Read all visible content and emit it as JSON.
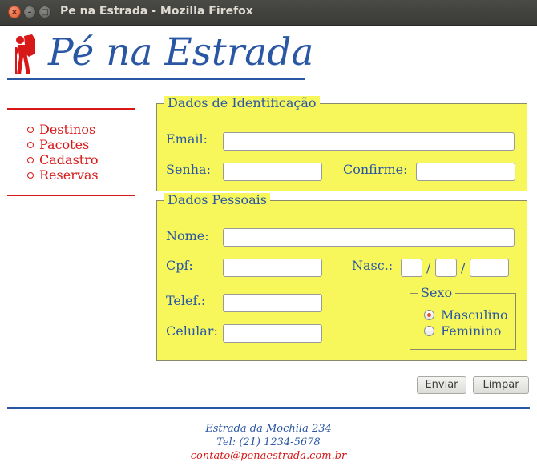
{
  "window": {
    "title": "Pe na Estrada - Mozilla Firefox"
  },
  "colors": {
    "brand_blue": "#2a57a4",
    "menu_red": "#d81818",
    "form_yellow": "#f7f75c"
  },
  "header": {
    "logo_icon": "hiker-icon",
    "brand": "Pé na Estrada"
  },
  "menu": {
    "items": [
      {
        "label": "Destinos"
      },
      {
        "label": "Pacotes"
      },
      {
        "label": "Cadastro"
      },
      {
        "label": "Reservas"
      }
    ]
  },
  "identification": {
    "legend": "Dados de Identificação",
    "email_label": "Email:",
    "email_value": "",
    "senha_label": "Senha:",
    "senha_value": "",
    "confirme_label": "Confirme:",
    "confirme_value": ""
  },
  "personal": {
    "legend": "Dados Pessoais",
    "nome_label": "Nome:",
    "nome_value": "",
    "cpf_label": "Cpf:",
    "cpf_value": "",
    "nasc_label": "Nasc.:",
    "nasc_day": "",
    "nasc_month": "",
    "nasc_year": "",
    "date_separator": "/",
    "telef_label": "Telef.:",
    "telef_value": "",
    "celular_label": "Celular:",
    "celular_value": ""
  },
  "sexo": {
    "legend": "Sexo",
    "options": [
      {
        "label": "Masculino",
        "checked": true
      },
      {
        "label": "Feminino",
        "checked": false
      }
    ]
  },
  "buttons": {
    "submit": "Enviar",
    "reset": "Limpar"
  },
  "footer": {
    "address": "Estrada da Mochila 234",
    "phone": "Tel: (21) 1234-5678",
    "email": "contato@penaestrada.com.br"
  }
}
